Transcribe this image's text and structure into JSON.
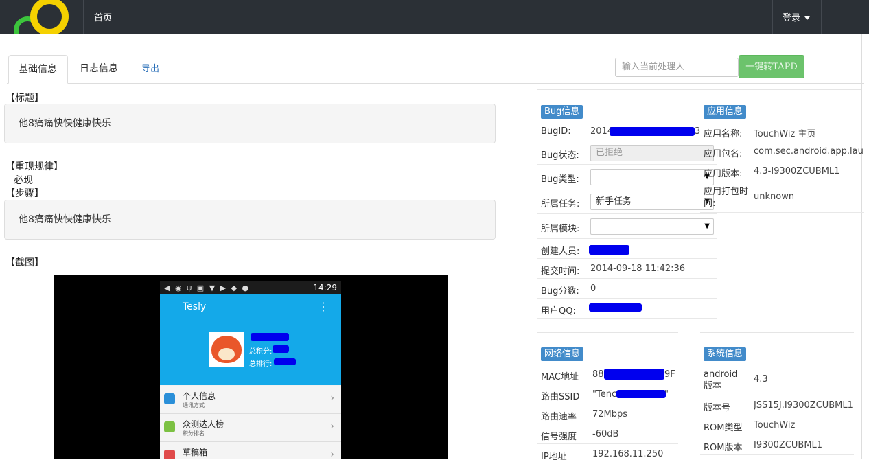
{
  "nav": {
    "home": "首页",
    "login": "登录"
  },
  "tabs": {
    "basic": "基础信息",
    "log": "日志信息",
    "export": "导出"
  },
  "assign": {
    "placeholder": "输入当前处理人",
    "button": "一键转TAPD"
  },
  "title": {
    "label": "【标题】",
    "value": "他8痛痛快快健康快乐"
  },
  "repro": {
    "label": "【重现规律】",
    "value": "必现"
  },
  "steps": {
    "label": "【步骤】",
    "value": "他8痛痛快快健康快乐"
  },
  "screenshot": {
    "label": "【截图】",
    "phone": {
      "time": "14:29",
      "app_title": "Tesly",
      "score_label": "总积分:",
      "rank_label": "总排行:",
      "items": [
        {
          "title": "个人信息",
          "sub": "通讯方式"
        },
        {
          "title": "众测达人榜",
          "sub": "积分排名"
        },
        {
          "title": "草稿箱",
          "sub": ""
        }
      ]
    }
  },
  "bug_info": {
    "header": "Bug信息",
    "bug_id_label": "BugID:",
    "bug_id_value": "2014",
    "bug_id_tail": "3",
    "status_label": "Bug状态:",
    "status_value": "已拒绝",
    "type_label": "Bug类型:",
    "type_value": "",
    "task_label": "所属任务:",
    "task_value": "新手任务",
    "module_label": "所属模块:",
    "module_value": "",
    "creator_label": "创建人员:",
    "submit_time_label": "提交时间:",
    "submit_time_value": "2014-09-18 11:42:36",
    "score_label": "Bug分数:",
    "score_value": "0",
    "qq_label": "用户QQ:"
  },
  "app_info": {
    "header": "应用信息",
    "name_label": "应用名称:",
    "name_value": "TouchWiz 主页",
    "package_label": "应用包名:",
    "package_value": "com.sec.android.app.launch",
    "version_label": "应用版本:",
    "version_value": "4.3-I9300ZCUBML1",
    "build_time_label": "应用打包时间:",
    "build_time_value": "unknown"
  },
  "network_info": {
    "header": "网络信息",
    "mac_label": "MAC地址",
    "mac_value_start": "88",
    "mac_value_end": "9F",
    "ssid_label": "路由SSID",
    "ssid_value_start": "\"Tenc",
    "ssid_value_end": "\"",
    "speed_label": "路由速率",
    "speed_value": "72Mbps",
    "signal_label": "信号强度",
    "signal_value": "-60dB",
    "ip_label": "IP地址",
    "ip_value": "192.168.11.250"
  },
  "system_info": {
    "header": "系统信息",
    "android_label": "android版本",
    "android_value": "4.3",
    "build_label": "版本号",
    "build_value": "JSS15J.I9300ZCUBML1",
    "rom_type_label": "ROM类型",
    "rom_type_value": "TouchWiz",
    "rom_version_label": "ROM版本",
    "rom_version_value": "I9300ZCUBML1"
  },
  "colors": {
    "topbar": "#2b3036",
    "badge": "#428bca",
    "tapd_button": "#6cc36c",
    "redaction": "#0000ee"
  }
}
